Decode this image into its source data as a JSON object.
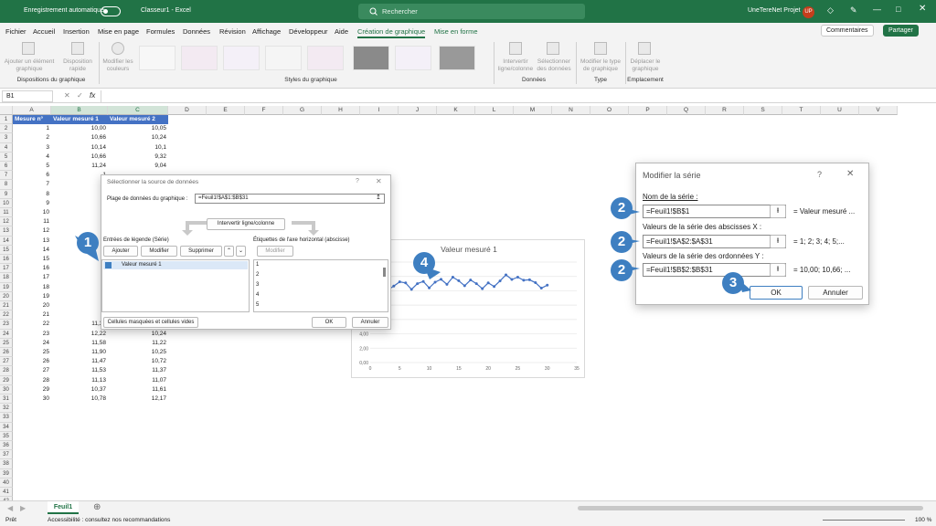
{
  "titlebar": {
    "autosave": "Enregistrement automatique",
    "filename": "Classeur1 - Excel",
    "search_placeholder": "Rechercher",
    "user": "UneTereNet Projet",
    "avatar": "UP"
  },
  "menu": [
    "Fichier",
    "Accueil",
    "Insertion",
    "Mise en page",
    "Formules",
    "Données",
    "Révision",
    "Affichage",
    "Développeur",
    "Aide",
    "Création de graphique",
    "Mise en forme"
  ],
  "comments_label": "Commentaires",
  "share_label": "Partager",
  "ribbon": {
    "add_element": "Ajouter un élément graphique",
    "quick_layout": "Disposition rapide",
    "change_colors": "Modifier les couleurs",
    "switch_row_col": "Intervertir ligne/colonne",
    "select_data": "Sélectionner des données",
    "change_type": "Modifier le type de graphique",
    "move_chart": "Déplacer le graphique",
    "group_layouts": "Dispositions du graphique",
    "group_styles": "Styles du graphique",
    "group_data": "Données",
    "group_type": "Type",
    "group_location": "Emplacement"
  },
  "formula": {
    "namebox": "B1",
    "fx": "fx"
  },
  "columns": [
    "A",
    "B",
    "C",
    "D",
    "E",
    "F",
    "G",
    "H",
    "I",
    "J",
    "K",
    "L",
    "M",
    "N",
    "O",
    "P",
    "Q",
    "R",
    "S",
    "T",
    "U",
    "V"
  ],
  "headers": [
    "Mesure n°",
    "Valeur mesuré 1",
    "Valeur mesuré 2"
  ],
  "rows": [
    [
      "1",
      "10,00",
      "10,05"
    ],
    [
      "2",
      "10,66",
      "10,24"
    ],
    [
      "3",
      "10,14",
      "10,1"
    ],
    [
      "4",
      "10,66",
      "9,32"
    ],
    [
      "5",
      "11,24",
      "9,04"
    ],
    [
      "6",
      "1",
      ""
    ],
    [
      "7",
      "1",
      ""
    ],
    [
      "8",
      "1",
      ""
    ],
    [
      "9",
      "1",
      ""
    ],
    [
      "10",
      "1",
      ""
    ],
    [
      "11",
      "1",
      ""
    ],
    [
      "12",
      "1",
      ""
    ],
    [
      "13",
      "1",
      ""
    ],
    [
      "14",
      "1",
      ""
    ],
    [
      "15",
      "1",
      ""
    ],
    [
      "16",
      "1",
      ""
    ],
    [
      "17",
      "1",
      ""
    ],
    [
      "18",
      "1",
      ""
    ],
    [
      "19",
      "1",
      ""
    ],
    [
      "20",
      "1",
      ""
    ],
    [
      "21",
      "1",
      ""
    ],
    [
      "22",
      "11,38",
      "9,65"
    ],
    [
      "23",
      "12,22",
      "10,24"
    ],
    [
      "24",
      "11,58",
      "11,22"
    ],
    [
      "25",
      "11,90",
      "10,25"
    ],
    [
      "26",
      "11,47",
      "10,72"
    ],
    [
      "27",
      "11,53",
      "11,37"
    ],
    [
      "28",
      "11,13",
      "11,07"
    ],
    [
      "29",
      "10,37",
      "11,61"
    ],
    [
      "30",
      "10,78",
      "12,17"
    ]
  ],
  "source_dialog": {
    "title": "Sélectionner la source de données",
    "range_label": "Plage de données du graphique :",
    "range_value": "=Feuil1!$A$1:$B$31",
    "switch_label": "Intervertir ligne/colonne",
    "legend_label": "Entrées de légende (Série)",
    "add": "Ajouter",
    "edit": "Modifier",
    "remove": "Supprimer",
    "series": [
      "Valeur mesuré 1"
    ],
    "axis_label": "Étiquettes de l'axe horizontal (abscisse)",
    "axis_edit": "Modifier",
    "axis_items": [
      "1",
      "2",
      "3",
      "4",
      "5"
    ],
    "hidden_cells": "Cellules masquées et cellules vides",
    "ok": "OK",
    "cancel": "Annuler"
  },
  "series_dialog": {
    "title": "Modifier la série",
    "name_label": "Nom de la série :",
    "name_value": "=Feuil1!$B$1",
    "name_preview": "= Valeur mesuré ...",
    "x_label": "Valeurs de la série des abscisses X :",
    "x_value": "=Feuil1!$A$2:$A$31",
    "x_preview": "= 1; 2; 3; 4; 5;...",
    "y_label": "Valeurs de la série des ordonnées Y :",
    "y_value": "=Feuil1!$B$2:$B$31",
    "y_preview": "= 10,00; 10,66; ...",
    "ok": "OK",
    "cancel": "Annuler"
  },
  "callouts": [
    "1",
    "2",
    "2",
    "2",
    "3",
    "4"
  ],
  "sheet": {
    "tab": "Feuil1"
  },
  "status": {
    "ready": "Prêt",
    "accessibility": "Accessibilité : consultez nos recommandations",
    "zoom": "100 %"
  },
  "chart_data": {
    "type": "scatter",
    "title": "Valeur mesuré 1",
    "series": [
      {
        "name": "Valeur mesuré 1",
        "x": [
          1,
          2,
          3,
          4,
          5,
          6,
          7,
          8,
          9,
          10,
          11,
          12,
          13,
          14,
          15,
          16,
          17,
          18,
          19,
          20,
          21,
          22,
          23,
          24,
          25,
          26,
          27,
          28,
          29,
          30
        ],
        "values": [
          10.0,
          10.66,
          10.14,
          10.66,
          11.24,
          11.1,
          10.2,
          11.0,
          11.3,
          10.4,
          11.2,
          11.6,
          10.9,
          11.9,
          11.4,
          10.7,
          11.5,
          11.0,
          10.3,
          11.1,
          10.6,
          11.38,
          12.22,
          11.58,
          11.9,
          11.47,
          11.53,
          11.13,
          10.37,
          10.78
        ]
      }
    ],
    "xlim": [
      0,
      35
    ],
    "ylim": [
      0,
      14
    ],
    "yticks": [
      "0,00",
      "2,00",
      "4,00"
    ],
    "xticks": [
      "0",
      "5",
      "10",
      "15",
      "20",
      "25",
      "30",
      "35"
    ],
    "color": "#4472c4"
  },
  "colors": {
    "excel_green": "#217346",
    "header_blue": "#4472c4",
    "callout_blue": "#3e7fc1"
  }
}
